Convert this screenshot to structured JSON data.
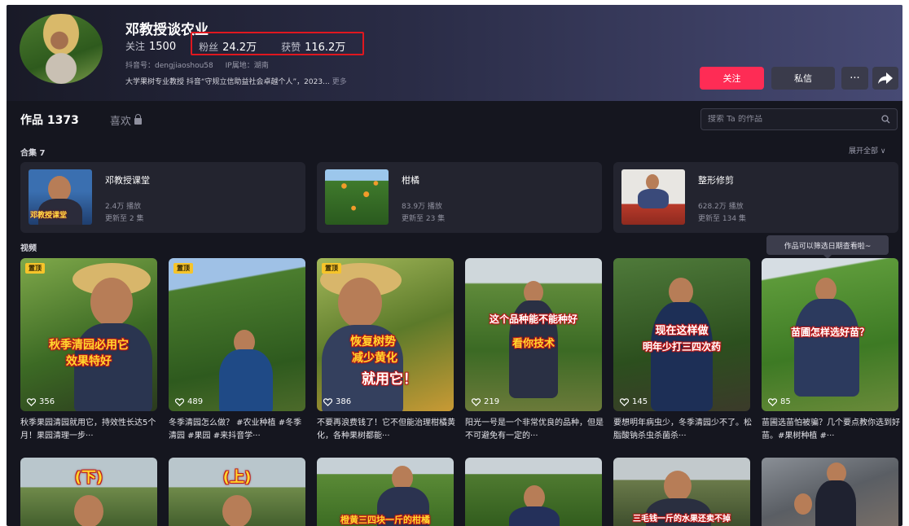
{
  "profile": {
    "name": "邓教授谈农业",
    "following_label": "关注",
    "following": "1500",
    "fans_label": "粉丝",
    "fans": "24.2万",
    "likes_label": "获赞",
    "likes": "116.2万",
    "douyin_id": "抖音号：dengjiaoshou58",
    "ip": "IP属地：湖南",
    "bio": "大学果树专业教授 抖音“守规立信助益社会卓越个人”，2023...",
    "bio_more": "更多"
  },
  "actions": {
    "follow": "关注",
    "message": "私信",
    "more": "···"
  },
  "tabs": {
    "works": "作品 1373",
    "likes": "喜欢"
  },
  "search": {
    "placeholder": "搜索 Ta 的作品"
  },
  "collections": {
    "label": "合集 7",
    "expand": "展开全部 ∨",
    "items": [
      {
        "title": "邓教授课堂",
        "plays": "2.4万 播放",
        "updated": "更新至 2 集",
        "thumb_text": "邓教授课堂"
      },
      {
        "title": "柑橘",
        "plays": "83.9万 播放",
        "updated": "更新至 23 集"
      },
      {
        "title": "整形修剪",
        "plays": "628.2万 播放",
        "updated": "更新至 134 集"
      }
    ]
  },
  "videos_label": "视频",
  "tooltip": "作品可以筛选日期查看啦~",
  "videos": [
    {
      "pinned": "置顶",
      "overlay": [
        "秋季清园必用它",
        "效果特好"
      ],
      "likes": "356",
      "title": "秋季果园清园就用它，持效性长达5个月！果园清理一步···"
    },
    {
      "pinned": "置顶",
      "overlay": [],
      "likes": "489",
      "title": "冬季清园怎么做？ #农业种植 #冬季清园 #果园 #来抖音学···"
    },
    {
      "pinned": "置顶",
      "overlay": [
        "恢复树势",
        "减少黄化",
        "就用它！"
      ],
      "likes": "386",
      "title": "不要再浪费钱了！它不但能治理柑橘黄化，各种果树都能···"
    },
    {
      "pinned": "",
      "overlay": [
        "这个品种能不能种好",
        "看你技术"
      ],
      "likes": "219",
      "title": "阳光一号是一个非常优良的品种，但是不可避免有一定的···"
    },
    {
      "pinned": "",
      "overlay": [
        "现在这样做",
        "明年少打三四次药"
      ],
      "likes": "145",
      "title": "要想明年病虫少，冬季清园少不了。松脂酸钠杀虫杀菌杀···"
    },
    {
      "pinned": "",
      "overlay": [
        "苗圃怎样选好苗？"
      ],
      "likes": "85",
      "title": "苗圃选苗怕被骗？几个要点教你选到好苗。#果树种植 #···"
    }
  ],
  "videos_row2": [
    {
      "overlay": "(下)"
    },
    {
      "overlay": "(上)"
    },
    {
      "overlay": "橙黄三四块一斤的柑橘"
    },
    {
      "overlay": ""
    },
    {
      "overlay": "三毛钱一斤的水果还卖不掉"
    },
    {
      "overlay": ""
    }
  ],
  "colors": {
    "accent": "#fe2c55",
    "highlight_box": "#e0171f",
    "pin_badge": "#f6c42a"
  }
}
